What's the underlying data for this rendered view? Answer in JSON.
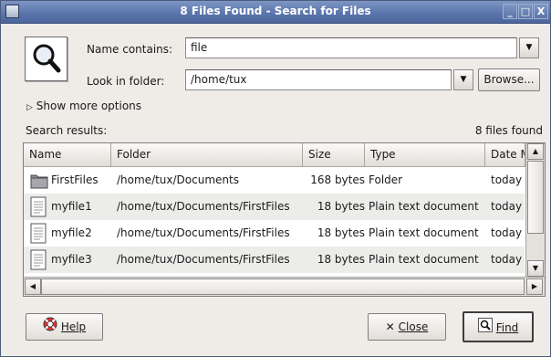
{
  "window": {
    "title": "8 Files Found - Search for Files",
    "buttons": {
      "minimize": "_",
      "maximize": "□",
      "close": "X"
    }
  },
  "form": {
    "name_contains_label": "Name contains:",
    "name_contains_value": "file",
    "look_in_label": "Look in folder:",
    "look_in_value": "/home/tux",
    "browse_label": "Browse...",
    "show_more_label": "Show more options"
  },
  "results": {
    "label": "Search results:",
    "count_text": "8 files found",
    "columns": [
      "Name",
      "Folder",
      "Size",
      "Type",
      "Date M"
    ],
    "rows": [
      {
        "icon": "folder-icon",
        "name": "FirstFiles",
        "folder": "/home/tux/Documents",
        "size": "168 bytes",
        "type": "Folder",
        "date": "today"
      },
      {
        "icon": "text-file-icon",
        "name": "myfile1",
        "folder": "/home/tux/Documents/FirstFiles",
        "size": "18 bytes",
        "type": "Plain text document",
        "date": "today"
      },
      {
        "icon": "text-file-icon",
        "name": "myfile2",
        "folder": "/home/tux/Documents/FirstFiles",
        "size": "18 bytes",
        "type": "Plain text document",
        "date": "today"
      },
      {
        "icon": "text-file-icon",
        "name": "myfile3",
        "folder": "/home/tux/Documents/FirstFiles",
        "size": "18 bytes",
        "type": "Plain text document",
        "date": "today"
      }
    ]
  },
  "footer": {
    "help_label": "Help",
    "close_label": "Close",
    "find_label": "Find"
  },
  "colors": {
    "titlebar": "#5b76ad",
    "window_bg": "#efebe7",
    "alt_row": "#ececea"
  }
}
